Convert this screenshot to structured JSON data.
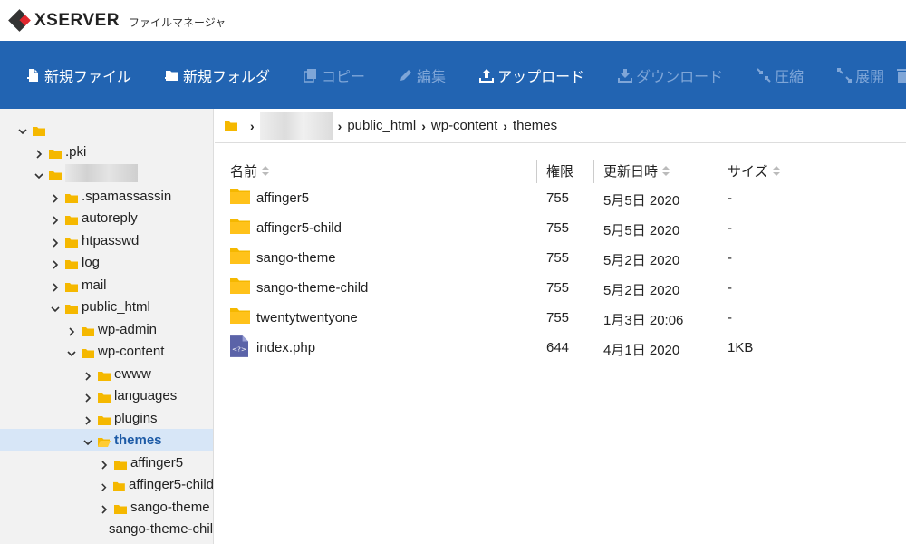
{
  "brand": {
    "name": "XSERVER",
    "subtitle": "ファイルマネージャ"
  },
  "toolbar": {
    "buttons": [
      {
        "label": "新規ファイル",
        "icon": "new-file-icon",
        "enabled": true
      },
      {
        "label": "新規フォルダ",
        "icon": "new-folder-icon",
        "enabled": true
      },
      {
        "label": "コピー",
        "icon": "copy-icon",
        "enabled": false
      },
      {
        "label": "編集",
        "icon": "edit-icon",
        "enabled": false
      },
      {
        "label": "アップロード",
        "icon": "upload-icon",
        "enabled": true
      },
      {
        "label": "ダウンロード",
        "icon": "download-icon",
        "enabled": false
      },
      {
        "label": "圧縮",
        "icon": "compress-icon",
        "enabled": false
      },
      {
        "label": "展開",
        "icon": "extract-icon",
        "enabled": false
      }
    ]
  },
  "tree": {
    "items": [
      {
        "label": "",
        "level": 0,
        "expanded": true
      },
      {
        "label": ".pki",
        "level": 1,
        "expanded": false
      },
      {
        "label": "",
        "level": 1,
        "expanded": true,
        "redacted": true
      },
      {
        "label": ".spamassassin",
        "level": 2,
        "expanded": false
      },
      {
        "label": "autoreply",
        "level": 2,
        "expanded": false
      },
      {
        "label": "htpasswd",
        "level": 2,
        "expanded": false
      },
      {
        "label": "log",
        "level": 2,
        "expanded": false
      },
      {
        "label": "mail",
        "level": 2,
        "expanded": false
      },
      {
        "label": "public_html",
        "level": 2,
        "expanded": true
      },
      {
        "label": "wp-admin",
        "level": 3,
        "expanded": false
      },
      {
        "label": "wp-content",
        "level": 3,
        "expanded": true
      },
      {
        "label": "ewww",
        "level": 4,
        "expanded": false
      },
      {
        "label": "languages",
        "level": 4,
        "expanded": false
      },
      {
        "label": "plugins",
        "level": 4,
        "expanded": false
      },
      {
        "label": "themes",
        "level": 4,
        "expanded": true,
        "selected": true
      },
      {
        "label": "affinger5",
        "level": 5,
        "expanded": false
      },
      {
        "label": "affinger5-child",
        "level": 5,
        "expanded": false
      },
      {
        "label": "sango-theme",
        "level": 5,
        "expanded": false
      },
      {
        "label": "sango-theme-child",
        "level": 5,
        "expanded": false
      }
    ]
  },
  "breadcrumb": {
    "parts": [
      "public_html",
      "wp-content",
      "themes"
    ]
  },
  "table": {
    "headers": {
      "name": "名前",
      "perm": "権限",
      "date": "更新日時",
      "size": "サイズ"
    },
    "rows": [
      {
        "type": "folder",
        "name": "affinger5",
        "perm": "755",
        "date": "5月5日 2020",
        "size": "-"
      },
      {
        "type": "folder",
        "name": "affinger5-child",
        "perm": "755",
        "date": "5月5日 2020",
        "size": "-"
      },
      {
        "type": "folder",
        "name": "sango-theme",
        "perm": "755",
        "date": "5月2日 2020",
        "size": "-"
      },
      {
        "type": "folder",
        "name": "sango-theme-child",
        "perm": "755",
        "date": "5月2日 2020",
        "size": "-"
      },
      {
        "type": "folder",
        "name": "twentytwentyone",
        "perm": "755",
        "date": "1月3日 20:06",
        "size": "-"
      },
      {
        "type": "php",
        "name": "index.php",
        "perm": "644",
        "date": "4月1日 2020",
        "size": "1KB"
      }
    ]
  },
  "colors": {
    "toolbar": "#2264b2",
    "folder": "#f5b800",
    "selected_bg": "#d7e6f7"
  }
}
